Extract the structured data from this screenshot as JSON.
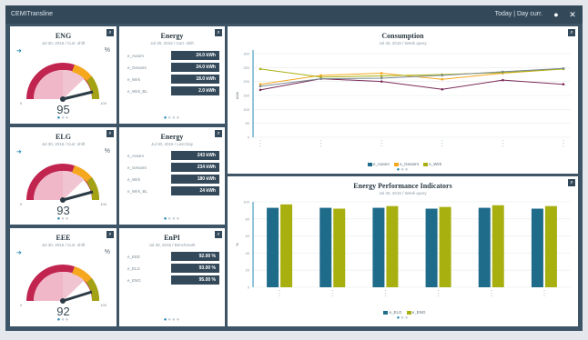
{
  "topbar": {
    "title": "CEMITransline",
    "range": "Today | Day curr."
  },
  "colors": {
    "pink": "#efb7c8",
    "crimson": "#c0244f",
    "orange": "#f5a81e",
    "olive": "#a3a215",
    "teal": "#1e6b8a",
    "lime": "#a8b010",
    "gray": "#7a8a94",
    "purple": "#7a2a58"
  },
  "gauges": [
    {
      "title": "ENG",
      "sub": "Jul 30, 2016 / Curr. shift",
      "value": "95",
      "min": "0",
      "max": "100",
      "unit": "%"
    },
    {
      "title": "ELG",
      "sub": "Jul 30, 2016 / Curr. shift",
      "value": "93",
      "min": "0",
      "max": "100",
      "unit": "%"
    },
    {
      "title": "EEE",
      "sub": "Jul 30, 2016 / Curr. shift",
      "value": "92",
      "min": "0",
      "max": "100",
      "unit": "%"
    }
  ],
  "energy1": {
    "title": "Energy",
    "sub": "Jul 30, 2016 / Curr. shift",
    "rows": [
      {
        "label": "e_Autom",
        "value": "24.0 kWh"
      },
      {
        "label": "e_Gesamt",
        "value": "24.0 kWh"
      },
      {
        "label": "e_Wirk",
        "value": "18.0 kWh"
      },
      {
        "label": "e_Wirk_BL",
        "value": "2.0 kWh"
      }
    ]
  },
  "energy2": {
    "title": "Energy",
    "sub": "Jul 30, 2016 / Last Day",
    "rows": [
      {
        "label": "e_Autom",
        "value": "243 kWh"
      },
      {
        "label": "e_Gesamt",
        "value": "234 kWh"
      },
      {
        "label": "e_Wirk",
        "value": "180 kWh"
      },
      {
        "label": "e_Wirk_BL",
        "value": "24 kWh"
      }
    ]
  },
  "enpi": {
    "title": "EnPI",
    "sub": "Jul 30, 2016 / Benchmark",
    "rows": [
      {
        "label": "e_EEE",
        "value": "92.00 %"
      },
      {
        "label": "e_ELG",
        "value": "93.00 %"
      },
      {
        "label": "e_ENG",
        "value": "95.00 %"
      }
    ]
  },
  "consumption": {
    "title": "Consumption",
    "sub": "Jul 25, 2016 / Week query"
  },
  "epi": {
    "title": "Energy Performance Indicators",
    "sub": "Jul 25, 2016 / Week query"
  },
  "chart_data": [
    {
      "type": "line",
      "title": "Consumption",
      "subtitle": "Jul 25, 2016 / Week query",
      "ylabel": "kWh",
      "ylim": [
        0,
        300
      ],
      "yticks": [
        "300",
        "250",
        "200",
        "150",
        "100",
        "50",
        "0"
      ],
      "series": [
        {
          "name": "e_Autom",
          "color": "#7a2a58",
          "values": [
            170,
            210,
            200,
            172,
            205,
            190
          ]
        },
        {
          "name": "e_Gesamt",
          "color": "#f5a81e",
          "values": [
            190,
            222,
            230,
            208,
            230,
            245
          ]
        },
        {
          "name": "e_Wirk",
          "color": "#a8b010",
          "values": [
            245,
            216,
            220,
            225,
            232,
            245
          ]
        },
        {
          "name": "",
          "color": "#7a8a94",
          "values": [
            183,
            210,
            212,
            222,
            235,
            247
          ]
        }
      ],
      "legend_position": "bottom",
      "grid": true
    },
    {
      "type": "bar",
      "title": "Energy Performance Indicators",
      "subtitle": "Jul 25, 2016 / Week query",
      "ylabel": "%",
      "ylim": [
        0,
        100
      ],
      "yticks": [
        "100",
        "80",
        "60",
        "40",
        "20",
        "0"
      ],
      "series": [
        {
          "name": "e_ELG",
          "color": "#1e6b8a",
          "values": [
            93,
            93,
            93,
            92,
            93,
            92
          ]
        },
        {
          "name": "e_ENG",
          "color": "#a8b010",
          "values": [
            97,
            92,
            95,
            94,
            96,
            95
          ]
        }
      ],
      "legend_position": "bottom",
      "grid": true
    }
  ]
}
